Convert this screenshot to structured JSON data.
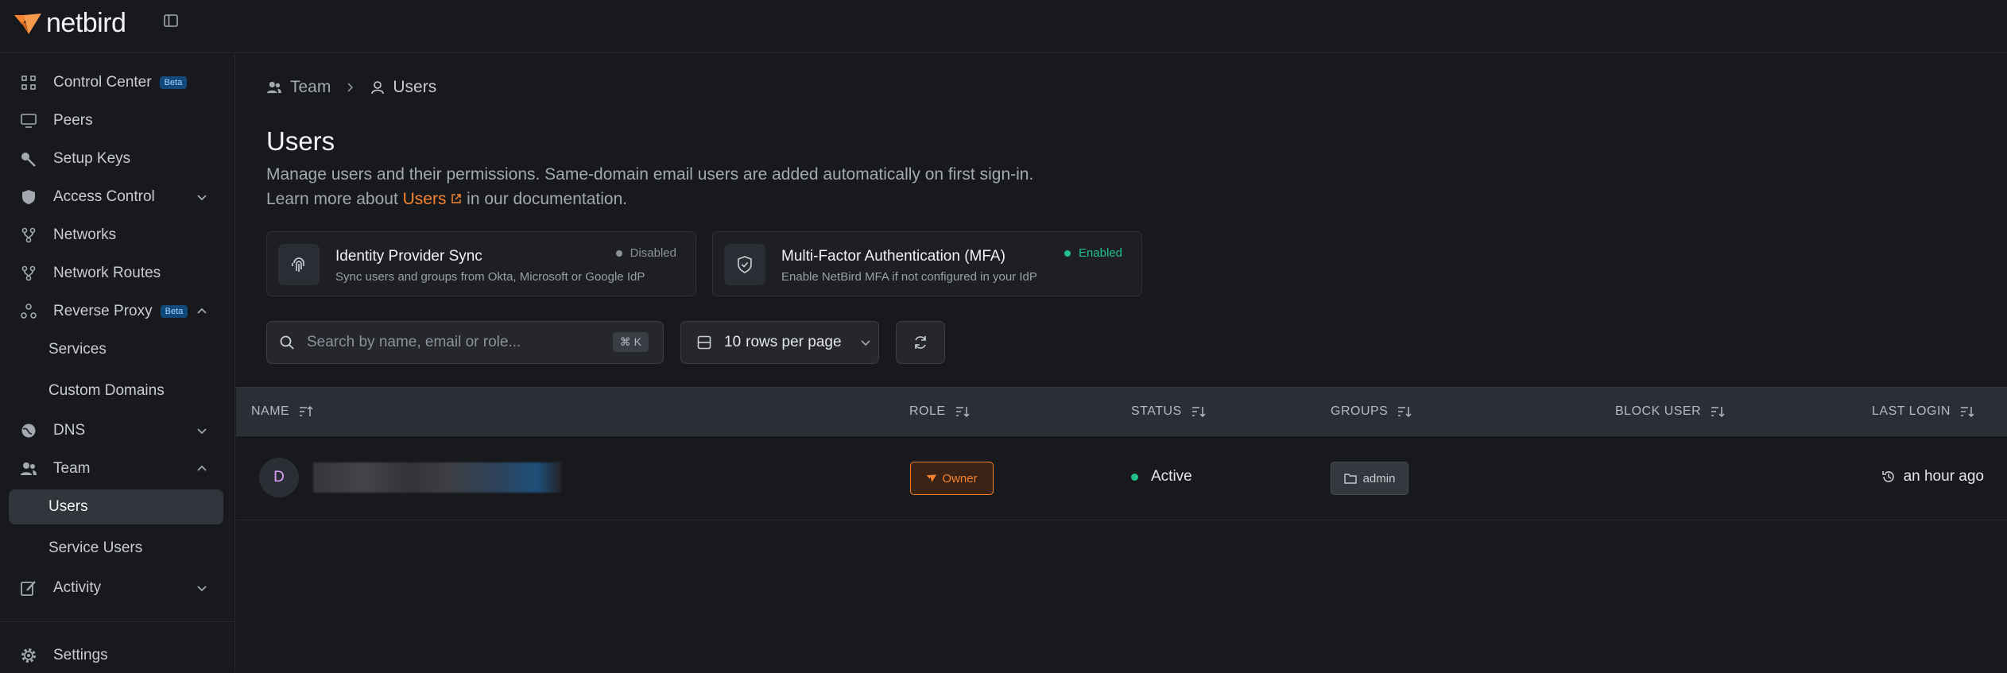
{
  "brand": {
    "name": "netbird",
    "accent": "#f68330"
  },
  "sidebar": {
    "items": [
      {
        "key": "control-center",
        "label": "Control Center",
        "badge": "Beta",
        "icon": "control-center-icon"
      },
      {
        "key": "peers",
        "label": "Peers",
        "icon": "monitor-icon"
      },
      {
        "key": "setup-keys",
        "label": "Setup Keys",
        "icon": "key-icon"
      },
      {
        "key": "access-control",
        "label": "Access Control",
        "icon": "shield-icon",
        "expandable": true
      },
      {
        "key": "networks",
        "label": "Networks",
        "icon": "network-icon"
      },
      {
        "key": "network-routes",
        "label": "Network Routes",
        "icon": "route-icon"
      },
      {
        "key": "reverse-proxy",
        "label": "Reverse Proxy",
        "badge": "Beta",
        "icon": "proxy-icon",
        "expanded": true
      },
      {
        "key": "services",
        "label": "Services",
        "sub": true
      },
      {
        "key": "custom-domains",
        "label": "Custom Domains",
        "sub": true
      },
      {
        "key": "dns",
        "label": "DNS",
        "icon": "globe-icon",
        "expandable": true
      },
      {
        "key": "team",
        "label": "Team",
        "icon": "team-icon",
        "expanded": true
      },
      {
        "key": "users",
        "label": "Users",
        "sub": true,
        "active": true
      },
      {
        "key": "service-users",
        "label": "Service Users",
        "sub": true
      },
      {
        "key": "activity",
        "label": "Activity",
        "icon": "activity-icon",
        "expandable": true
      },
      {
        "key": "settings",
        "label": "Settings",
        "icon": "gear-icon"
      }
    ]
  },
  "breadcrumb": {
    "parent": "Team",
    "current": "Users"
  },
  "page": {
    "title": "Users",
    "description": "Manage users and their permissions. Same-domain email users are added automatically on first sign-in.",
    "learn_prefix": "Learn more about",
    "learn_link": "Users",
    "learn_suffix": "in our documentation."
  },
  "cards": {
    "idp": {
      "title": "Identity Provider Sync",
      "subtitle": "Sync users and groups from Okta, Microsoft or Google IdP",
      "status": "Disabled",
      "status_color": "#8d919a"
    },
    "mfa": {
      "title": "Multi-Factor Authentication (MFA)",
      "subtitle": "Enable NetBird MFA if not configured in your IdP",
      "status": "Enabled",
      "status_color": "#22c08a"
    }
  },
  "toolbar": {
    "search_placeholder": "Search by name, email or role...",
    "search_shortcut": "⌘ K",
    "rows_value": "10",
    "rows_suffix": "rows per page"
  },
  "table": {
    "columns": {
      "name": "NAME",
      "role": "ROLE",
      "status": "STATUS",
      "groups": "GROUPS",
      "block": "BLOCK USER",
      "last_login": "LAST LOGIN"
    },
    "rows": [
      {
        "avatar": "D",
        "role": "Owner",
        "status": "Active",
        "status_color": "#22c08a",
        "group": "admin",
        "last_login": "an hour ago"
      }
    ]
  }
}
